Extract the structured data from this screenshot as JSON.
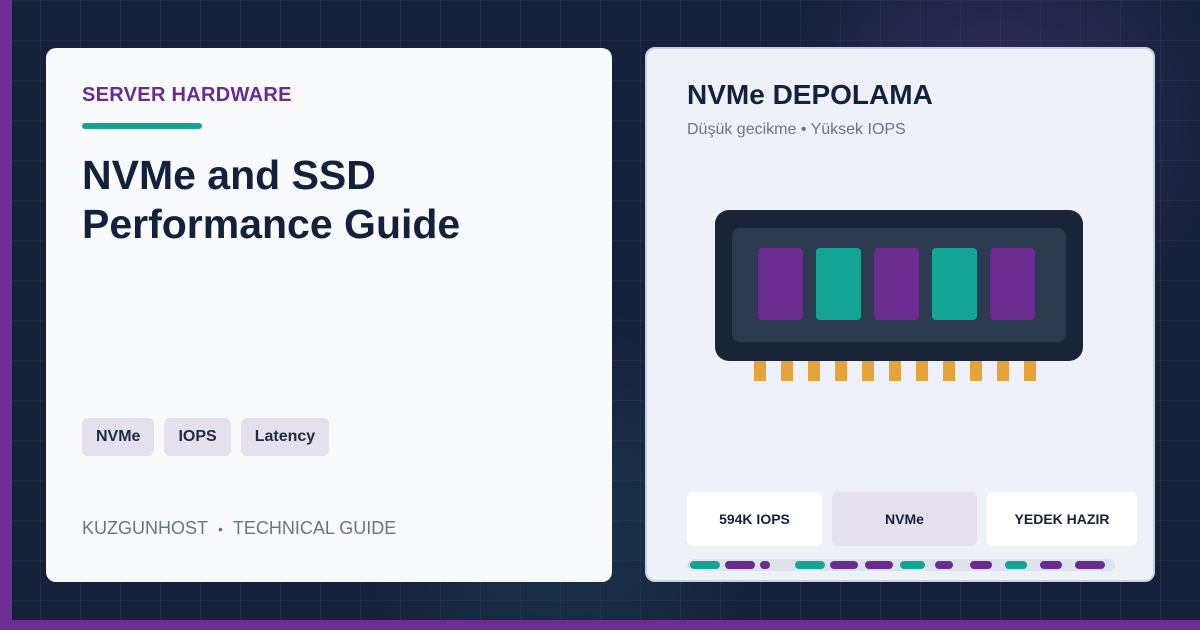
{
  "left_card": {
    "eyebrow": "SERVER HARDWARE",
    "title": "NVMe and SSD Performance Guide",
    "tags": [
      "NVMe",
      "IOPS",
      "Latency"
    ],
    "footer": {
      "brand": "KUZGUNHOST",
      "separator": "•",
      "label": "TECHNICAL GUIDE"
    }
  },
  "right_card": {
    "title": "NVMe DEPOLAMA",
    "subtitle": "Düşük gecikme • Yüksek IOPS",
    "stats": [
      "594K IOPS",
      "NVMe",
      "YEDEK HAZIR"
    ]
  },
  "colors": {
    "purple": "#6a2c8e",
    "teal": "#14a496",
    "navy": "#14213d",
    "gold": "#e6a33a"
  },
  "icons": {
    "drive": "nvme-drive-illustration"
  }
}
